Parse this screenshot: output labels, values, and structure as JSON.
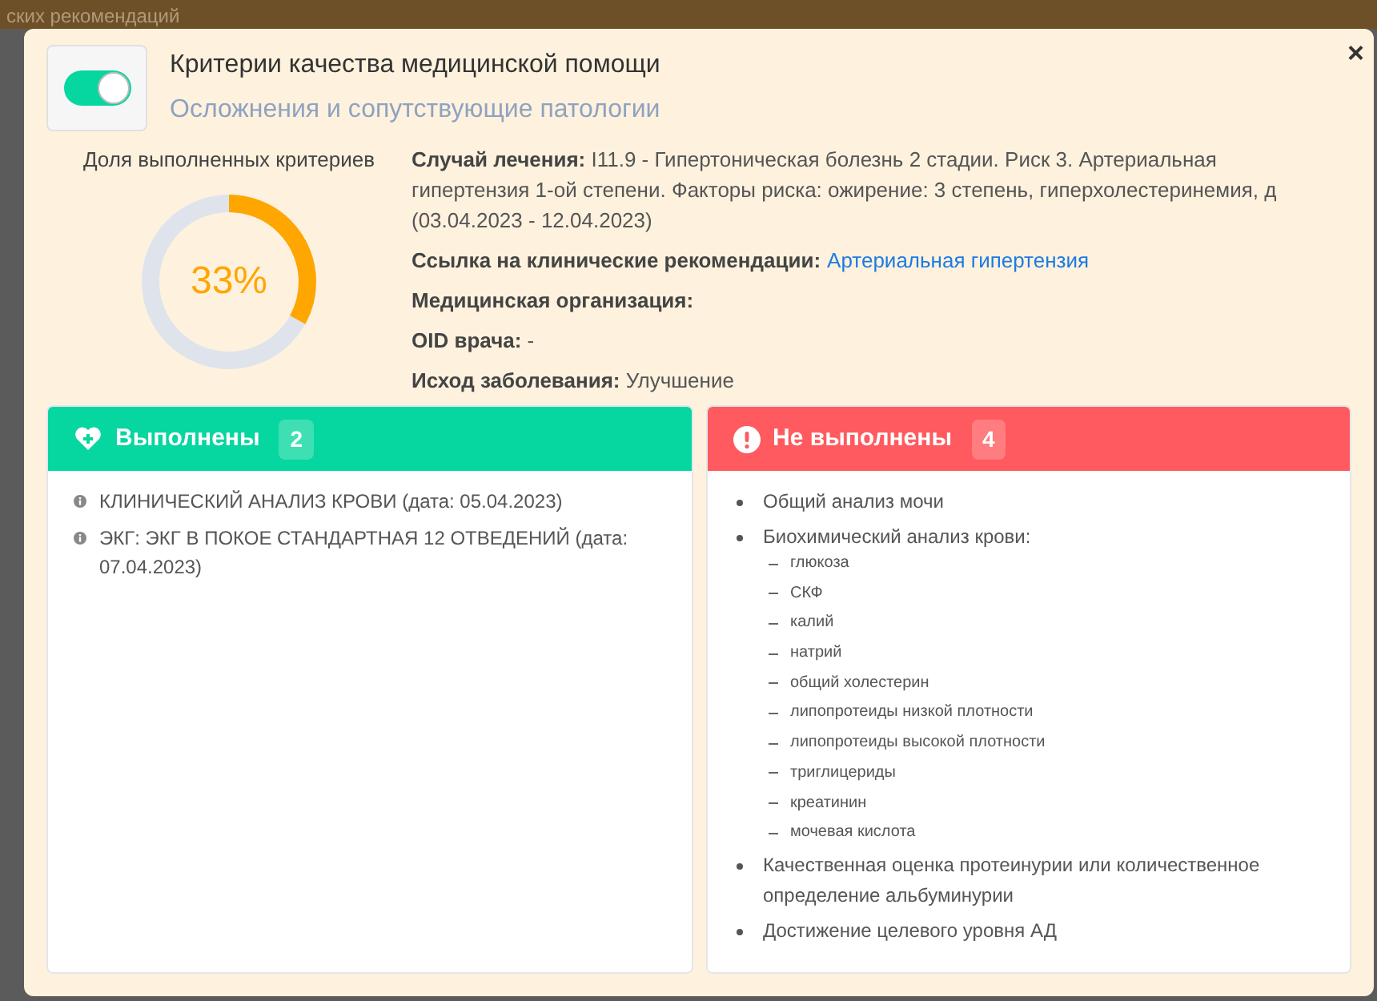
{
  "background": {
    "title": "ских рекомендаций"
  },
  "modal": {
    "toggle": {
      "on": true
    },
    "title": "Критерии качества медицинской помощи",
    "subtitle": "Осложнения и сопутствующие патологии",
    "close": "×"
  },
  "progress": {
    "label": "Доля выполненных критериев",
    "level": 0.33,
    "value": "33%"
  },
  "info": {
    "case": {
      "label": "Случай лечения:",
      "value": "I11.9 - Гипертоническая болезнь 2 стадии. Риск 3. Артериальная гипертензия 1-ой степени. Факторы риска: ожирение: 3 степень, гиперхолестеринемия, д (03.04.2023 - 12.04.2023)"
    },
    "guideline": {
      "label": "Ссылка на клинические рекомендации:",
      "link": "Артериальная гипертензия"
    },
    "organization": {
      "label": "Медицинская организация:"
    },
    "doctor_oid": {
      "label": "OID врача:",
      "value": "-"
    },
    "outcome": {
      "label": "Исход заболевания:",
      "value": "Улучшение"
    }
  },
  "done": {
    "title": "Выполнены",
    "count": "2",
    "items": [
      {
        "text": "КЛИНИЧЕСКИЙ АНАЛИЗ КРОВИ (дата: 05.04.2023)"
      },
      {
        "text": "ЭКГ: ЭКГ В ПОКОЕ СТАНДАРТНАЯ 12 ОТВЕДЕНИЙ (дата: 07.04.2023)"
      }
    ]
  },
  "not_done": {
    "title": "Не выполнены",
    "count": "4",
    "items": [
      {
        "text": "Общий анализ мочи"
      },
      {
        "text": "Биохимический анализ крови:",
        "children": [
          {
            "text": "глюкоза"
          },
          {
            "text": "СКФ"
          },
          {
            "text": "калий"
          },
          {
            "text": "натрий"
          },
          {
            "text": "общий холестерин"
          },
          {
            "text": "липопротеиды низкой плотности"
          },
          {
            "text": "липопротеиды высокой плотности"
          },
          {
            "text": "триглицериды"
          },
          {
            "text": "креатинин"
          },
          {
            "text": "мочевая кислота"
          }
        ]
      },
      {
        "text": "Качественная оценка протеинурии или количественное определение альбуминурии"
      },
      {
        "text": "Достижение целевого уровня АД"
      }
    ]
  }
}
